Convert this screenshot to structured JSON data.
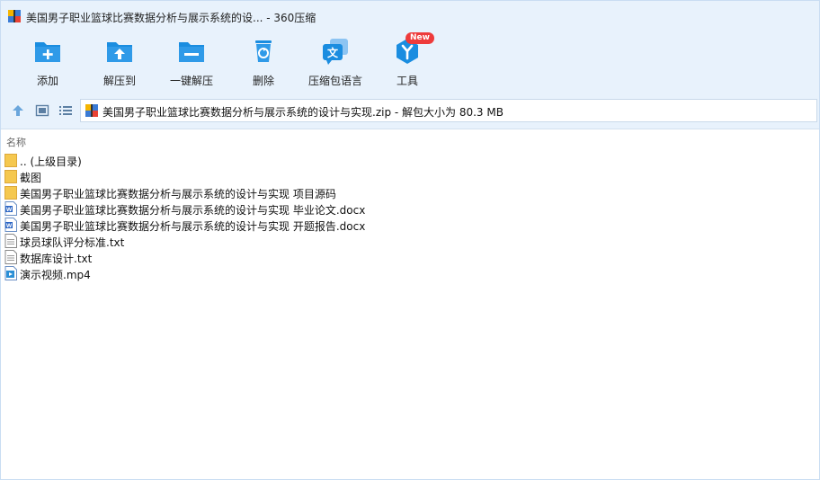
{
  "window": {
    "title": "美国男子职业篮球比赛数据分析与展示系统的设... - 360压缩"
  },
  "toolbar": {
    "add": "添加",
    "extract_to": "解压到",
    "one_click_extract": "一键解压",
    "delete": "删除",
    "language": "压缩包语言",
    "tools": "工具",
    "tools_badge": "New"
  },
  "address": {
    "path": "美国男子职业篮球比赛数据分析与展示系统的设计与实现.zip - 解包大小为 80.3 MB"
  },
  "columns": {
    "name": "名称"
  },
  "files": [
    {
      "name": ".. (上级目录)",
      "type": "folder"
    },
    {
      "name": "截图",
      "type": "folder"
    },
    {
      "name": "美国男子职业篮球比赛数据分析与展示系统的设计与实现 项目源码",
      "type": "folder"
    },
    {
      "name": "美国男子职业篮球比赛数据分析与展示系统的设计与实现 毕业论文.docx",
      "type": "docx"
    },
    {
      "name": "美国男子职业篮球比赛数据分析与展示系统的设计与实现 开题报告.docx",
      "type": "docx"
    },
    {
      "name": "球员球队评分标准.txt",
      "type": "txt"
    },
    {
      "name": "数据库设计.txt",
      "type": "txt"
    },
    {
      "name": "演示视频.mp4",
      "type": "mp4"
    }
  ],
  "colors": {
    "chrome_bg": "#e8f2fc",
    "accent": "#1a8de0",
    "folder": "#f5c84f",
    "badge": "#ee3b3b"
  }
}
